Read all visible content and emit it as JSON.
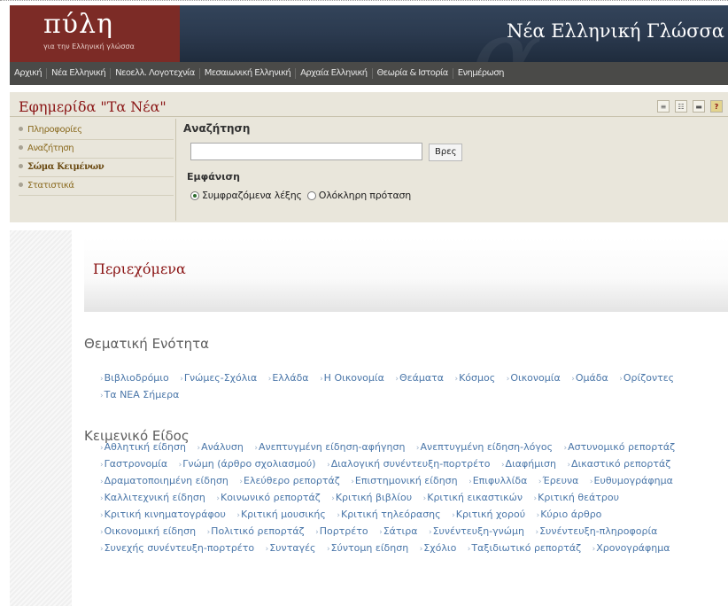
{
  "header": {
    "logo_title": "πύλη",
    "logo_subtitle": "για την Ελληνική γλώσσα",
    "site_title": "Νέα Ελληνική Γλώσσα"
  },
  "nav": [
    "Αρχική",
    "Νέα Ελληνική",
    "Νεοελλ. Λογοτεχνία",
    "Μεσαιωνική Ελληνική",
    "Αρχαία Ελληνική",
    "Θεωρία & Ιστορία",
    "Ενημέρωση"
  ],
  "panel": {
    "title": "Εφημερίδα \"Τα Νέα\"",
    "tools": [
      "≡",
      "☷",
      "▬",
      "?"
    ],
    "sidebar": [
      {
        "label": "Πληροφορίες"
      },
      {
        "label": "Αναζήτηση"
      },
      {
        "label": "Σώμα Κειμένων"
      },
      {
        "label": "Στατιστικά"
      }
    ],
    "search_label": "Αναζήτηση",
    "search_value": "",
    "search_button": "Βρες",
    "display_label": "Εμφάνιση",
    "radio_1": "Συμφραζόμενα λέξης",
    "radio_2": "Ολόκληρη πρόταση"
  },
  "content": {
    "title": "Περιεχόμενα",
    "section1_title": "Θεματική Ενότητα",
    "section1_tags": [
      "Βιβλιοδρόμιο",
      "Γνώμες-Σχόλια",
      "Ελλάδα",
      "Η Οικονομία",
      "Θεάματα",
      "Κόσμος",
      "Οικονομία",
      "Ομάδα",
      "Ορίζοντες",
      "Τα ΝΕΑ Σήμερα"
    ],
    "section2_title": "Κειμενικό Είδος",
    "section2_tags": [
      "Αθλητική είδηση",
      "Ανάλυση",
      "Ανεπτυγμένη είδηση-αφήγηση",
      "Ανεπτυγμένη είδηση-λόγος",
      "Αστυνομικό ρεπορτάζ",
      "Γαστρονομία",
      "Γνώμη (άρθρο σχολιασμού)",
      "Διαλογική συνέντευξη-πορτρέτο",
      "Διαφήμιση",
      "Δικαστικό ρεπορτάζ",
      "Δραματοποιημένη είδηση",
      "Ελεύθερο ρεπορτάζ",
      "Επιστημονική είδηση",
      "Επιφυλλίδα",
      "Έρευνα",
      "Ευθυμογράφημα",
      "Καλλιτεχνική είδηση",
      "Κοινωνικό ρεπορτάζ",
      "Κριτική βιβλίου",
      "Κριτική εικαστικών",
      "Κριτική θεάτρου",
      "Κριτική κινηματογράφου",
      "Κριτική μουσικής",
      "Κριτική τηλεόρασης",
      "Κριτική χορού",
      "Κύριο άρθρο",
      "Οικονομική είδηση",
      "Πολιτικό ρεπορτάζ",
      "Πορτρέτο",
      "Σάτιρα",
      "Συνέντευξη-γνώμη",
      "Συνέντευξη-πληροφορία",
      "Συνεχής συνέντευξη-πορτρέτο",
      "Συνταγές",
      "Σύντομη είδηση",
      "Σχόλιο",
      "Ταξιδιωτικό ρεπορτάζ",
      "Χρονογράφημα"
    ]
  }
}
